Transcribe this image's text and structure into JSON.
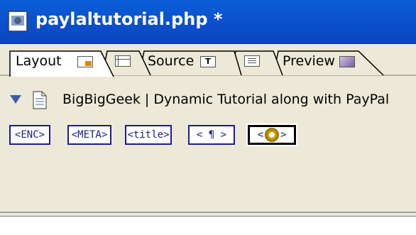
{
  "window": {
    "title": "paylaltutorial.php *",
    "title_icon": "document-icon"
  },
  "tabs": [
    {
      "label": "Layout",
      "icon": "layout-view-icon",
      "active": true
    },
    {
      "label": "",
      "icon": "table-view-icon",
      "active": false
    },
    {
      "label": "Source",
      "icon": "source-text-icon",
      "active": false
    },
    {
      "label": "",
      "icon": "list-view-icon",
      "active": false
    },
    {
      "label": "Preview",
      "icon": "preview-icon",
      "active": false
    }
  ],
  "head": {
    "collapse_icon": "collapse-triangle-icon",
    "page_icon": "page-icon",
    "title": "BigBigGeek | Dynamic Tutorial along with PayPal"
  },
  "tag_buttons": [
    {
      "label": "<ENC>",
      "name": "enc"
    },
    {
      "label": "<META>",
      "name": "meta"
    },
    {
      "label": "<title>",
      "name": "title"
    },
    {
      "label": "< ¶ >",
      "name": "link"
    },
    {
      "label": "",
      "name": "script",
      "icon": "gear-icon",
      "selected": true
    }
  ],
  "colors": {
    "titlebar": "#0c4fcb",
    "tab_bg": "#ece9d8",
    "tag_border": "#1d1d8e"
  }
}
